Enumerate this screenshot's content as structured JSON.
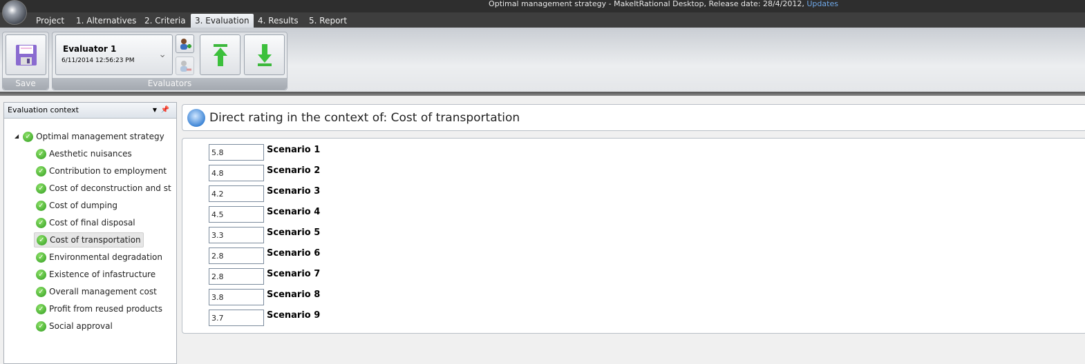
{
  "window": {
    "title": "Optimal management strategy - MakeItRational Desktop, Release date: 28/4/2012,",
    "updates_link": "Updates"
  },
  "tabs": [
    {
      "label": "Project"
    },
    {
      "label": "1. Alternatives"
    },
    {
      "label": "2. Criteria"
    },
    {
      "label": "3. Evaluation",
      "active": true
    },
    {
      "label": "4. Results"
    },
    {
      "label": "5. Report"
    }
  ],
  "ribbon": {
    "save_group": "Save",
    "evaluators_group": "Evaluators",
    "evaluator": {
      "name": "Evaluator 1",
      "date": "6/11/2014 12:56:23 PM"
    }
  },
  "left_panel": {
    "title": "Evaluation context",
    "root": "Optimal management strategy",
    "items": [
      "Aesthetic nuisances",
      "Contribution to employment",
      "Cost of deconstruction and st",
      "Cost of dumping",
      "Cost of final disposal",
      "Cost of transportation",
      "Environmental degradation",
      "Existence of infastructure",
      "Overall management cost",
      "Profit from reused products",
      "Social approval"
    ],
    "selected": "Cost of transportation"
  },
  "main": {
    "title": "Direct rating in the context of: Cost of transportation",
    "ratings": [
      {
        "value": "5.8",
        "label": "Scenario 1"
      },
      {
        "value": "4.8",
        "label": "Scenario 2"
      },
      {
        "value": "4.2",
        "label": "Scenario 3"
      },
      {
        "value": "4.5",
        "label": "Scenario 4"
      },
      {
        "value": "3.3",
        "label": "Scenario 5"
      },
      {
        "value": "2.8",
        "label": "Scenario 6"
      },
      {
        "value": "2.8",
        "label": "Scenario 7"
      },
      {
        "value": "3.8",
        "label": "Scenario 8"
      },
      {
        "value": "3.7",
        "label": "Scenario 9"
      }
    ]
  },
  "colors": {
    "check": "#2e9a1e",
    "link": "#6fa8e8"
  }
}
